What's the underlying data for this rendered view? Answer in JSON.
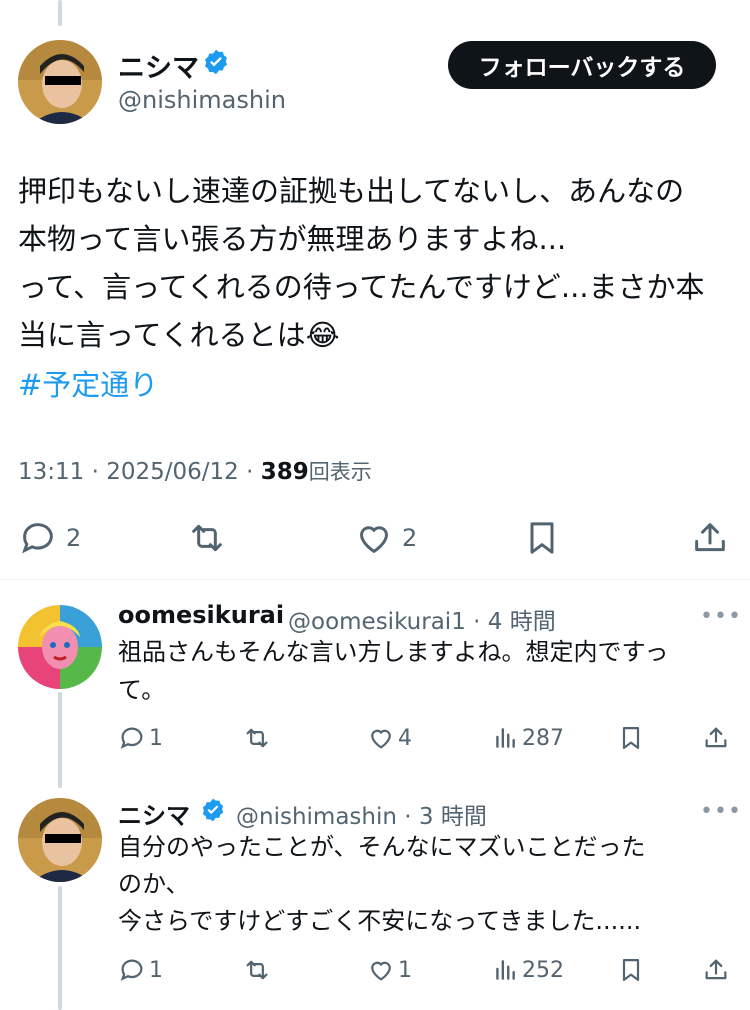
{
  "main_tweet": {
    "name": "ニシマ",
    "handle": "@nishimashin",
    "follow_button": "フォローバックする",
    "text_lines": [
      "押印もないし速達の証拠も出してないし、あんなの",
      "本物って言い張る方が無理ありますよね...",
      "って、言ってくれるの待ってたんですけど...まさか本",
      "当に言ってくれるとは"
    ],
    "emoji": "😂",
    "hashtag": "#予定通り",
    "timestamp": "13:11 · 2025/06/12 · ",
    "views_count": "389",
    "views_label": "回表示",
    "actions": {
      "replies": "2",
      "retweets": "",
      "likes": "2"
    }
  },
  "replies": [
    {
      "name": "oomesikurai",
      "handle_time": "@oomesikurai1 · 4 時間",
      "text_lines": [
        "祖品さんもそんな言い方しますよね。想定内ですっ",
        "て。"
      ],
      "replies": "1",
      "retweets": "",
      "likes": "4",
      "views": "287",
      "more": "•••"
    },
    {
      "name": "ニシマ",
      "handle_time": "@nishimashin · 3 時間",
      "text_lines": [
        "自分のやったことが、そんなにマズいことだった",
        "のか、",
        "今さらですけどすごく不安になってきました......"
      ],
      "replies": "1",
      "retweets": "",
      "likes": "1",
      "views": "252",
      "more": "•••"
    }
  ],
  "colors": {
    "accent": "#1d9bf0",
    "text": "#0f1419",
    "muted": "#536471",
    "line": "#cfd9de"
  }
}
